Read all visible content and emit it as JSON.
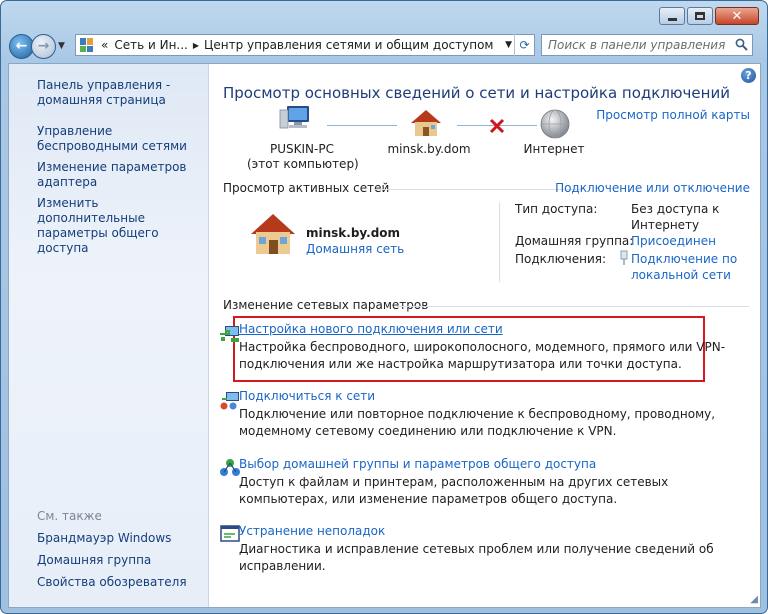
{
  "window": {
    "colors": {
      "accent": "#1a66c6",
      "highlight": "#d6181f",
      "title": "#1e3d78"
    }
  },
  "address_bar": {
    "chevron": "«",
    "segments": [
      "Сеть и Ин...",
      "Центр управления сетями и общим доступом"
    ]
  },
  "search": {
    "placeholder": "Поиск в панели управления"
  },
  "sidebar": {
    "home": "Панель управления - домашняя страница",
    "links": [
      "Управление беспроводными сетями",
      "Изменение параметров адаптера",
      "Изменить дополнительные параметры общего доступа"
    ],
    "see_also_label": "См. также",
    "see_also": [
      "Брандмауэр Windows",
      "Домашняя группа",
      "Свойства обозревателя"
    ]
  },
  "main": {
    "title": "Просмотр основных сведений о сети и настройка подключений",
    "view_full_map": "Просмотр полной карты",
    "map": {
      "pc_name": "PUSKIN-PC",
      "pc_sub": "(этот компьютер)",
      "network": "minsk.by.dom",
      "internet": "Интернет"
    },
    "active": {
      "heading": "Просмотр активных сетей",
      "connect_link": "Подключение или отключение",
      "network_name": "minsk.by.dom",
      "network_type": "Домашняя сеть",
      "access_label": "Тип доступа:",
      "access_value": "Без доступа к Интернету",
      "homegroup_label": "Домашняя группа:",
      "homegroup_value": "Присоединен",
      "connections_label": "Подключения:",
      "connections_value": "Подключение по локальной сети"
    },
    "change": {
      "heading": "Изменение сетевых параметров",
      "tasks": [
        {
          "title": "Настройка нового подключения или сети",
          "desc": "Настройка беспроводного, широкополосного, модемного, прямого или VPN-подключения или же настройка маршрутизатора или точки доступа.",
          "icon": "new-connection-icon"
        },
        {
          "title": "Подключиться к сети",
          "desc": "Подключение или повторное подключение к беспроводному, проводному, модемному сетевому соединению или подключение к VPN.",
          "icon": "connect-network-icon"
        },
        {
          "title": "Выбор домашней группы и параметров общего доступа",
          "desc": "Доступ к файлам и принтерам, расположенным на других сетевых компьютерах, или изменение параметров общего доступа.",
          "icon": "homegroup-icon"
        },
        {
          "title": "Устранение неполадок",
          "desc": "Диагностика и исправление сетевых проблем или получение сведений об исправлении.",
          "icon": "troubleshoot-icon"
        }
      ]
    }
  }
}
